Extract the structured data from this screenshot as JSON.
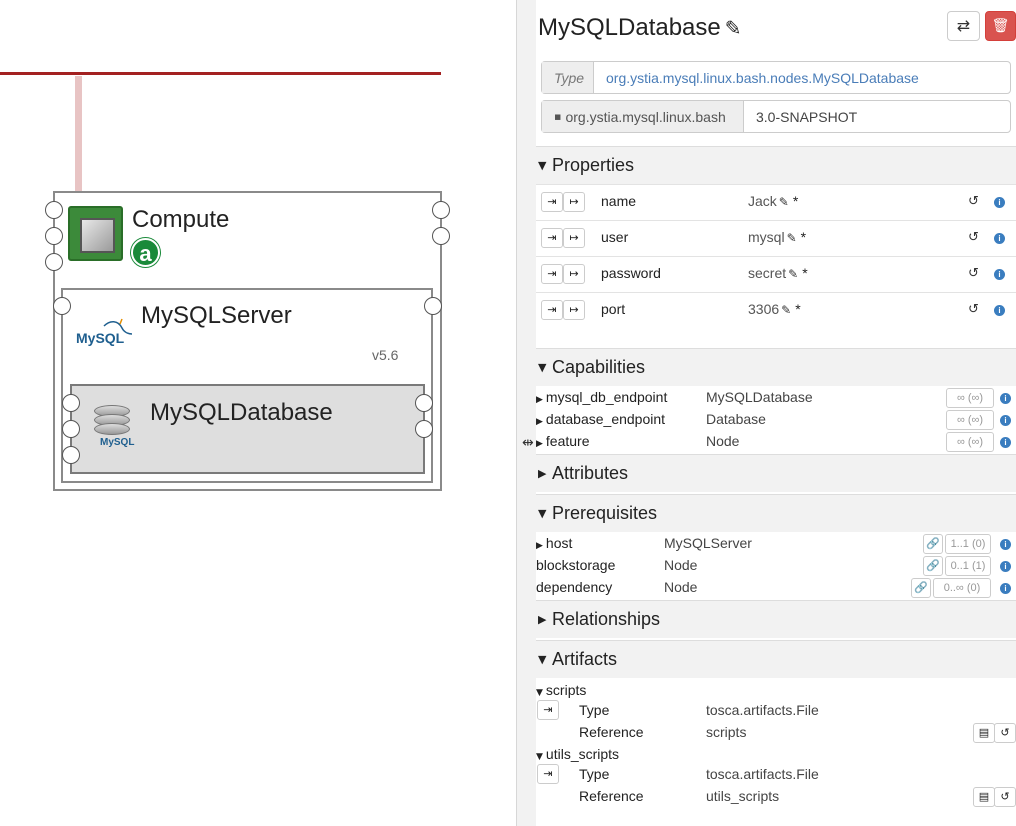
{
  "canvas": {
    "compute": {
      "name": "Compute",
      "badge": "a"
    },
    "server": {
      "name": "MySQLServer",
      "version": "v5.6",
      "logo_text": "MySQL"
    },
    "database": {
      "name": "MySQLDatabase",
      "logo_text": "MySQL"
    }
  },
  "header": {
    "title": "MySQLDatabase"
  },
  "type_row": {
    "label": "Type",
    "value": "org.ystia.mysql.linux.bash.nodes.MySQLDatabase"
  },
  "archive_row": {
    "name": "org.ystia.mysql.linux.bash",
    "version": "3.0-SNAPSHOT"
  },
  "sections": {
    "properties": "Properties",
    "capabilities": "Capabilities",
    "attributes": "Attributes",
    "prerequisites": "Prerequisites",
    "relationships": "Relationships",
    "artifacts": "Artifacts"
  },
  "properties": [
    {
      "name": "name",
      "value": "Jack",
      "required": "*"
    },
    {
      "name": "user",
      "value": "mysql",
      "required": "*"
    },
    {
      "name": "password",
      "value": "secret",
      "required": "*"
    },
    {
      "name": "port",
      "value": "3306",
      "required": "*"
    }
  ],
  "capabilities": [
    {
      "name": "mysql_db_endpoint",
      "type": "MySQLDatabase",
      "bounds": "∞ (∞)"
    },
    {
      "name": "database_endpoint",
      "type": "Database",
      "bounds": "∞ (∞)"
    },
    {
      "name": "feature",
      "type": "Node",
      "bounds": "∞ (∞)"
    }
  ],
  "prerequisites": [
    {
      "name": "host",
      "type": "MySQLServer",
      "bounds": "1..1 (0)"
    },
    {
      "name": "blockstorage",
      "type": "Node",
      "bounds": "0..1 (1)"
    },
    {
      "name": "dependency",
      "type": "Node",
      "bounds": "0..∞ (0)"
    }
  ],
  "artifacts": [
    {
      "name": "scripts",
      "type_label": "Type",
      "type": "tosca.artifacts.File",
      "ref_label": "Reference",
      "reference": "scripts"
    },
    {
      "name": "utils_scripts",
      "type_label": "Type",
      "type": "tosca.artifacts.File",
      "ref_label": "Reference",
      "reference": "utils_scripts"
    }
  ],
  "colors": {
    "danger": "#d9534f",
    "link_blue": "#4a7db8",
    "connector_red": "#a32121",
    "badge_green": "#1a8a3a"
  }
}
